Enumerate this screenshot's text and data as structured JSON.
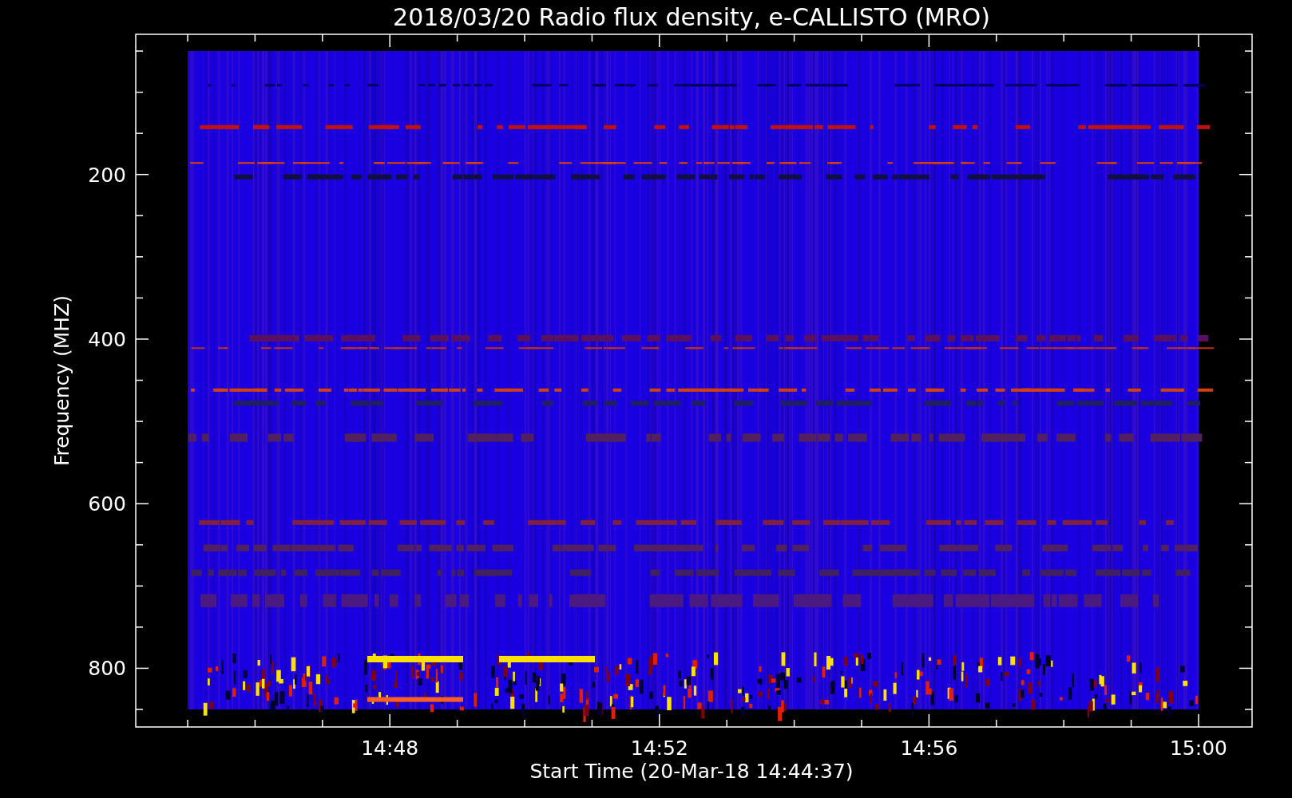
{
  "title": "2018/03/20  Radio flux density, e-CALLISTO (MRO)",
  "plot": {
    "ylabel": "Frequency (MHZ)",
    "xlabel": "Start Time (20-Mar-18 14:44:37)",
    "yticks": [
      "200",
      "400",
      "600",
      "800"
    ],
    "xticks": [
      "14:48",
      "14:52",
      "14:56",
      "15:00"
    ]
  }
}
